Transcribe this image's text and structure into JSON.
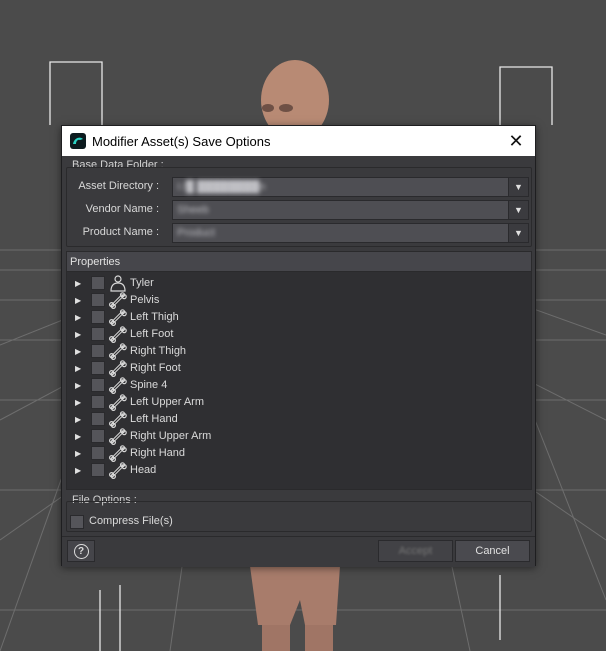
{
  "dialog": {
    "title": "Modifier Asset(s) Save Options"
  },
  "base_data_folder": {
    "label": "Base Data Folder :",
    "fields": [
      {
        "label": "Asset Directory :",
        "value": "I:/█ ████████n"
      },
      {
        "label": "Vendor Name :",
        "value": "Sheeb"
      },
      {
        "label": "Product Name :",
        "value": "Product"
      }
    ]
  },
  "properties": {
    "header": "Properties",
    "items": [
      {
        "label": "Tyler",
        "icon": "figure-icon"
      },
      {
        "label": "Pelvis",
        "icon": "bone-icon"
      },
      {
        "label": "Left Thigh",
        "icon": "bone-icon"
      },
      {
        "label": "Left Foot",
        "icon": "bone-icon"
      },
      {
        "label": "Right Thigh",
        "icon": "bone-icon"
      },
      {
        "label": "Right Foot",
        "icon": "bone-icon"
      },
      {
        "label": "Spine 4",
        "icon": "bone-icon"
      },
      {
        "label": "Left Upper Arm",
        "icon": "bone-icon"
      },
      {
        "label": "Left Hand",
        "icon": "bone-icon"
      },
      {
        "label": "Right Upper Arm",
        "icon": "bone-icon"
      },
      {
        "label": "Right Hand",
        "icon": "bone-icon"
      },
      {
        "label": "Head",
        "icon": "bone-icon"
      }
    ]
  },
  "file_options": {
    "label": "File Options :",
    "compress_label": "Compress File(s)"
  },
  "buttons": {
    "accept": "Accept",
    "cancel": "Cancel"
  }
}
